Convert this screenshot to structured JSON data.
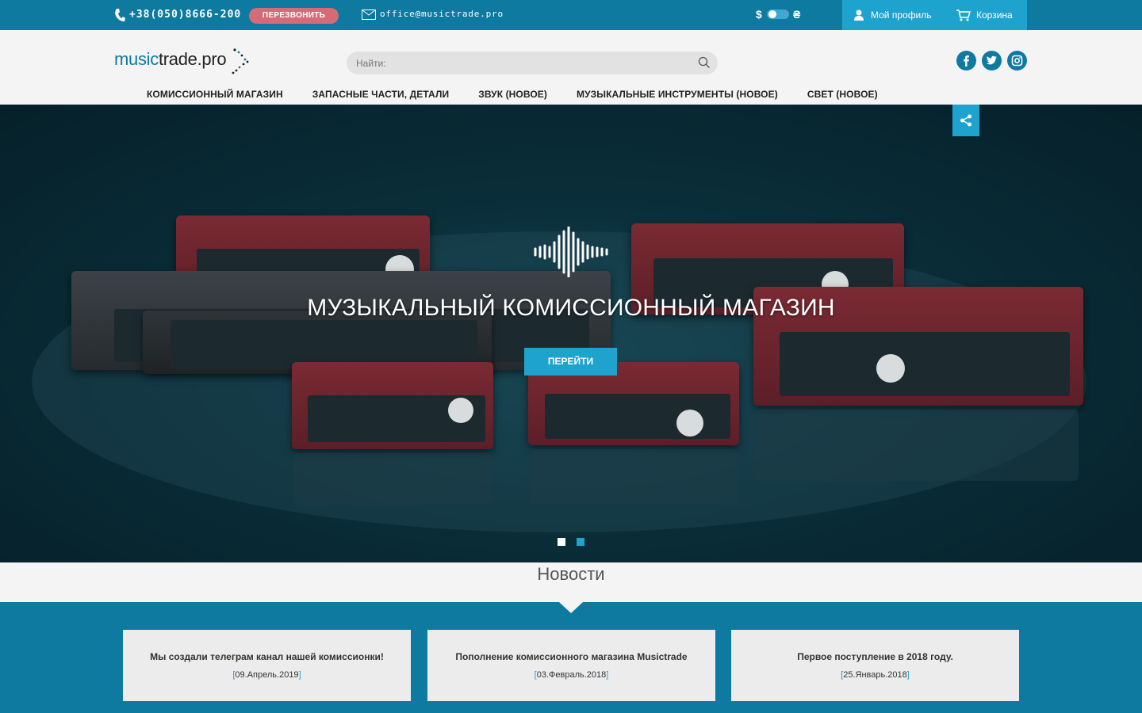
{
  "topbar": {
    "phone": "+38(050)8666-200",
    "callback_label": "ПЕРЕЗВОНИТЬ",
    "email": "office@musictrade.pro",
    "currency_usd": "$",
    "currency_uah": "₴",
    "profile_label": "Мой профиль",
    "cart_label": "Корзина"
  },
  "header": {
    "logo_part1": "music",
    "logo_part2": "trade.pro",
    "search_placeholder": "Найти:"
  },
  "nav": {
    "items": [
      "КОМИССИОННЫЙ МАГАЗИН",
      "ЗАПАСНЫЕ ЧАСТИ, ДЕТАЛИ",
      "ЗВУК (НОВОЕ)",
      "МУЗЫКАЛЬНЫЕ ИНСТРУМЕНТЫ (НОВОЕ)",
      "СВЕТ (НОВОЕ)"
    ]
  },
  "hero": {
    "title": "МУЗЫКАЛЬНЫЙ КОМИССИОННЫЙ МАГАЗИН",
    "button_label": "ПЕРЕЙТИ",
    "slides_count": 2,
    "active_slide": 2
  },
  "news": {
    "title": "Новости",
    "items": [
      {
        "title": "Мы создали телеграм канал нашей комиссионки!",
        "date": "09.Апрель.2019"
      },
      {
        "title": "Пополнение комиссионного магазина Musictrade",
        "date": "03.Февраль.2018"
      },
      {
        "title": "Первое поступление в 2018 году.",
        "date": "25.Январь.2018"
      }
    ]
  },
  "colors": {
    "primary": "#0e7aa0",
    "accent": "#1ea3cf",
    "callback": "#d86a78"
  }
}
